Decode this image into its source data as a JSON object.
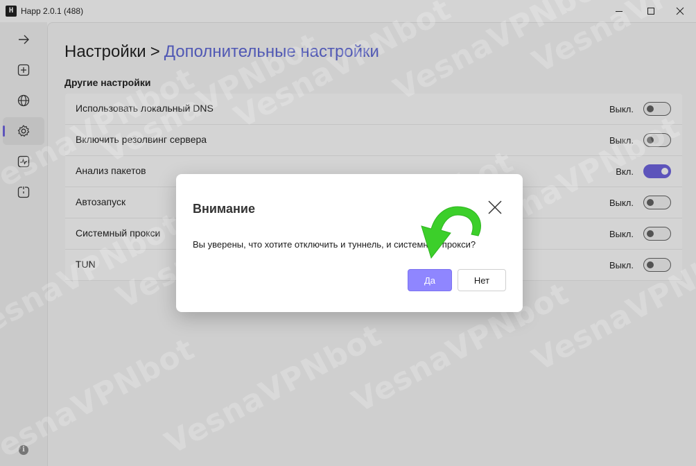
{
  "window": {
    "title": "Happ 2.0.1 (488)",
    "app_icon_glyph": "H"
  },
  "sidebar": {
    "items": [
      {
        "name": "arrow-right-icon"
      },
      {
        "name": "add-icon"
      },
      {
        "name": "globe-icon"
      },
      {
        "name": "gear-icon",
        "active": true
      },
      {
        "name": "activity-icon"
      },
      {
        "name": "timer-icon"
      }
    ],
    "info_glyph": "i"
  },
  "header": {
    "breadcrumb_root": "Настройки",
    "breadcrumb_sep": ">",
    "breadcrumb_current": "Дополнительные настройки"
  },
  "section": {
    "title": "Другие настройки"
  },
  "settings": [
    {
      "label": "Использовать локальный DNS",
      "state": "Выкл.",
      "on": false
    },
    {
      "label": "Включить резолвинг сервера",
      "state": "Выкл.",
      "on": false
    },
    {
      "label": "Анализ пакетов",
      "state": "Вкл.",
      "on": true
    },
    {
      "label": "Автозапуск",
      "state": "Выкл.",
      "on": false
    },
    {
      "label": "Системный прокси",
      "state": "Выкл.",
      "on": false
    },
    {
      "label": "TUN",
      "state": "Выкл.",
      "on": false
    }
  ],
  "dialog": {
    "title": "Внимание",
    "message": "Вы уверены, что хотите отключить и туннель, и системный прокси?",
    "yes_label": "Да",
    "no_label": "Нет"
  },
  "watermark": {
    "text": "VesnaVPNbot"
  },
  "colors": {
    "accent": "#6b5fe0",
    "link": "#5a64d8",
    "yes_button": "#8f86ff",
    "arrow": "#3ccf2a"
  }
}
